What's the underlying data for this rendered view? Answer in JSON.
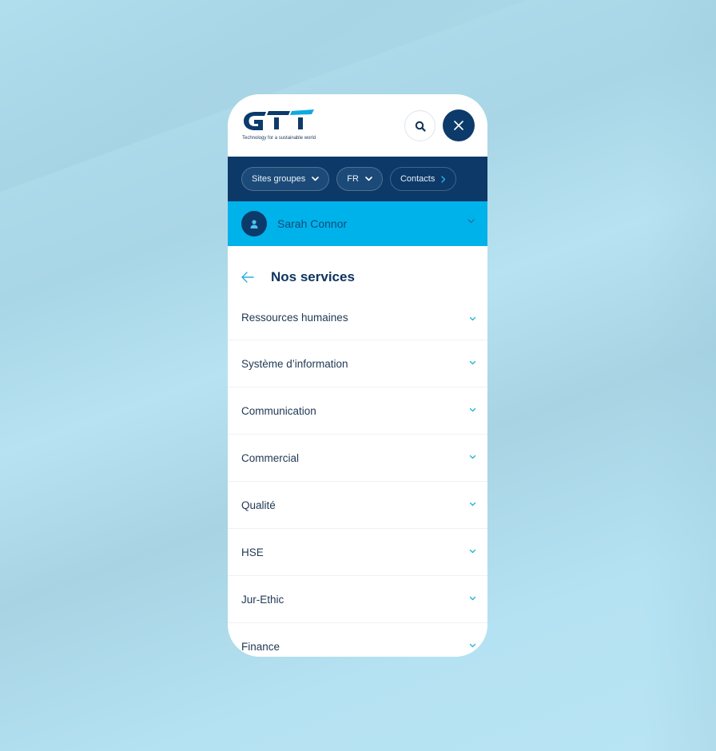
{
  "colors": {
    "navy": "#0c3968",
    "cyan": "#00b2ea",
    "accent_chevron": "#1fb6c8",
    "text_dark": "#213a55"
  },
  "header": {
    "logo_text": "GTT",
    "tagline": "Technology for a sustainable world",
    "search_icon": "search-icon",
    "close_icon": "close-icon"
  },
  "nav": {
    "items": [
      {
        "label": "Sites groupes",
        "icon": "chevron-down-icon"
      },
      {
        "label": "FR",
        "icon": "chevron-down-icon"
      },
      {
        "label": "Contacts",
        "icon": "chevron-right-icon"
      }
    ]
  },
  "user": {
    "name": "Sarah Connor",
    "avatar_icon": "user-icon",
    "chevron_icon": "chevron-down-icon"
  },
  "section": {
    "back_icon": "arrow-left-icon",
    "title": "Nos services"
  },
  "services": [
    {
      "label": "Ressources humaines"
    },
    {
      "label": "Système d’information"
    },
    {
      "label": "Communication"
    },
    {
      "label": "Commercial"
    },
    {
      "label": "Qualité"
    },
    {
      "label": "HSE"
    },
    {
      "label": "Jur-Ethic"
    },
    {
      "label": "Finance"
    }
  ]
}
